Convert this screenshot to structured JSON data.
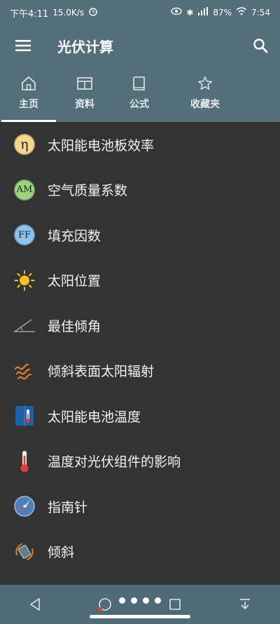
{
  "status_bar": {
    "time": "下午4:11",
    "net_speed": "15.0K/s",
    "battery": "87%",
    "extra": "7:54"
  },
  "app_bar": {
    "title": "光伏计算"
  },
  "tabs": [
    {
      "label": "主页",
      "icon": "home-icon",
      "active": true
    },
    {
      "label": "资料",
      "icon": "table-icon",
      "active": false
    },
    {
      "label": "公式",
      "icon": "book-icon",
      "active": false
    },
    {
      "label": "收藏夹",
      "icon": "star-icon",
      "active": false
    }
  ],
  "items": [
    {
      "label": "太阳能电池板效率",
      "badge": "η",
      "badge_color": "#f5d78e"
    },
    {
      "label": "空气质量系数",
      "badge": "AM",
      "badge_color": "#9bd37e"
    },
    {
      "label": "填充因数",
      "badge": "FF",
      "badge_color": "#8fc3ec"
    },
    {
      "label": "太阳位置",
      "icon": "sun-icon"
    },
    {
      "label": "最佳倾角",
      "icon": "tilt-angle-icon"
    },
    {
      "label": "倾斜表面太阳辐射",
      "icon": "radiation-waves-icon"
    },
    {
      "label": "太阳能电池温度",
      "icon": "solar-cell-temp-icon"
    },
    {
      "label": "温度对光伏组件的影响",
      "icon": "thermometer-icon"
    },
    {
      "label": "指南针",
      "icon": "compass-icon"
    },
    {
      "label": "倾斜",
      "icon": "inclination-icon"
    }
  ],
  "colors": {
    "app_bar": "#546e7a",
    "background": "#333333",
    "accent": "#ffffff"
  }
}
